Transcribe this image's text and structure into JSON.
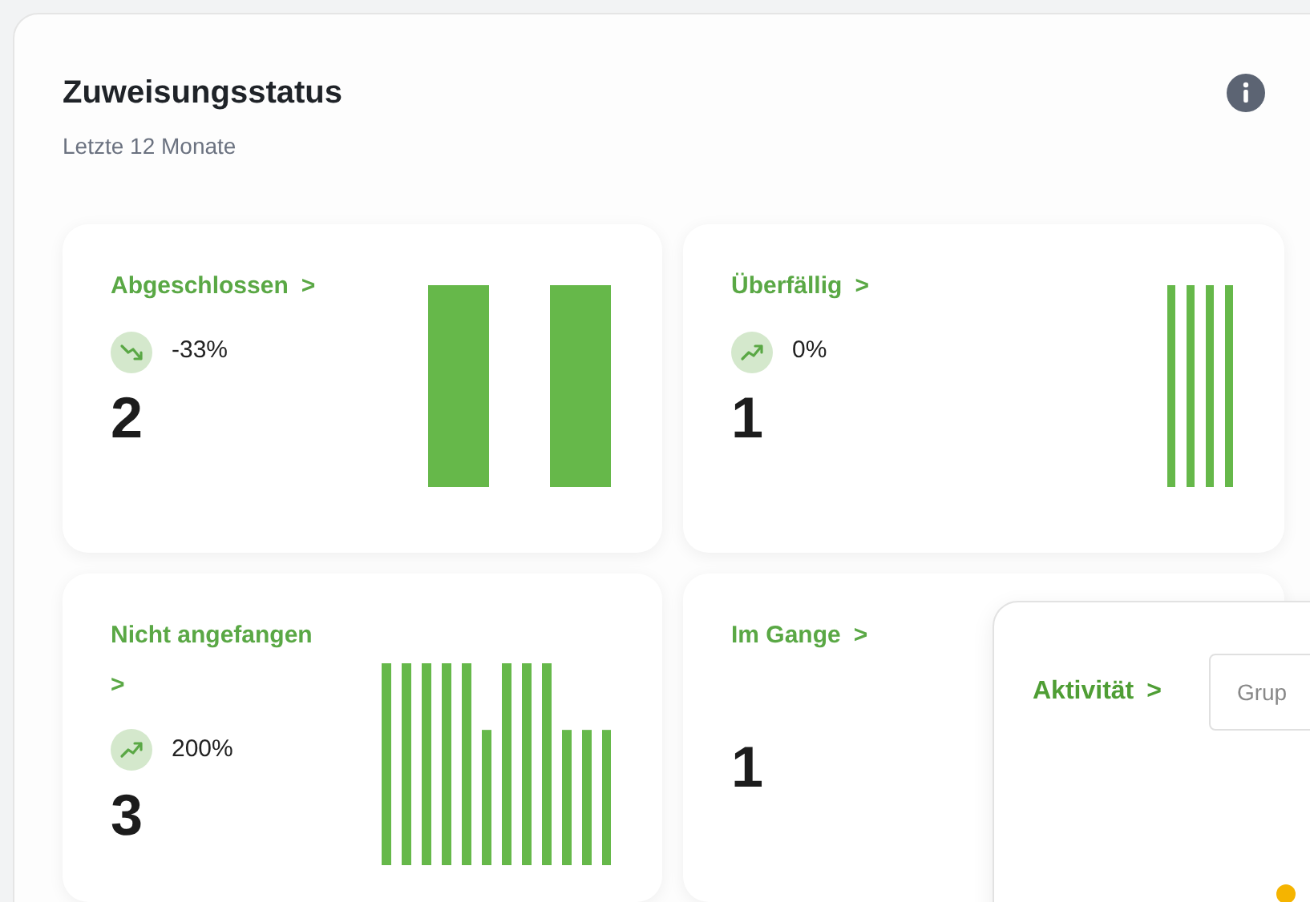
{
  "panel": {
    "title": "Zuweisungsstatus",
    "subtitle": "Letzte 12 Monate"
  },
  "cards": [
    {
      "kind": "falling",
      "label": "Abgeschlossen",
      "chevron": ">",
      "change": "-33%",
      "count": "2"
    },
    {
      "kind": "rising",
      "label": "Überfällig",
      "chevron": ">",
      "change": "0%",
      "count": "1"
    },
    {
      "kind": "rising",
      "label": "Nicht angefangen",
      "chevron": ">",
      "change": "200%",
      "count": "3"
    },
    {
      "kind": "plain",
      "label": "Im Gange",
      "chevron": ">",
      "count": "1"
    }
  ],
  "overlay": {
    "title": "Aktivität",
    "chevron": ">",
    "field_placeholder": "Grup"
  }
}
